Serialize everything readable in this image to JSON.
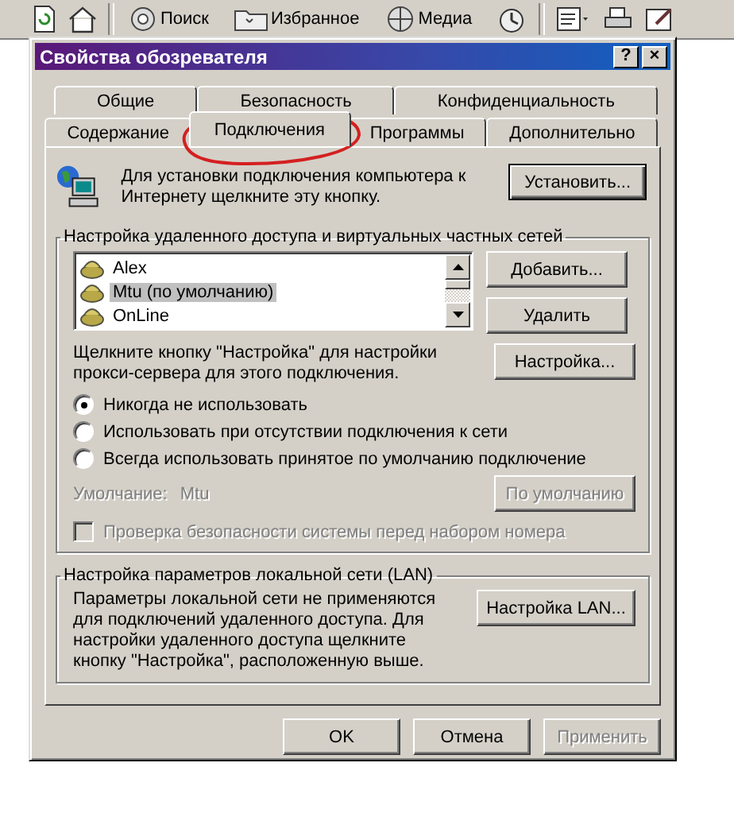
{
  "browser_toolbar": {
    "buttons": [
      {
        "label": "Поиск",
        "kind": "search"
      },
      {
        "label": "Избранное",
        "kind": "favorites"
      },
      {
        "label": "Медиа",
        "kind": "media"
      }
    ]
  },
  "window": {
    "title": "Свойства обозревателя",
    "title_buttons": [
      "?",
      "×"
    ]
  },
  "tab_rows": [
    [
      {
        "label": "Общие",
        "selected": false
      },
      {
        "label": "Безопасность",
        "selected": false
      },
      {
        "label": "Конфиденциальность",
        "selected": false
      }
    ],
    [
      {
        "label": "Содержание",
        "selected": false
      },
      {
        "label": "Подключения",
        "selected": true
      },
      {
        "label": "Программы",
        "selected": false
      },
      {
        "label": "Дополнительно",
        "selected": false
      }
    ]
  ],
  "setup": {
    "text": "Для установки подключения компьютера к Интернету щелкните эту кнопку.",
    "button": "Установить..."
  },
  "dialup": {
    "title": "Настройка удаленного доступа и виртуальных частных сетей",
    "connections": [
      {
        "name": "Alex",
        "selected": false
      },
      {
        "name": "Mtu (по умолчанию)",
        "selected": true
      },
      {
        "name": "OnLine",
        "selected": false
      }
    ],
    "buttons": [
      "Добавить...",
      "Удалить",
      "Настройка..."
    ],
    "hint": "Щелкните кнопку \"Настройка\" для настройки прокси-сервера для этого подключения.",
    "options": [
      {
        "label": "Никогда не использовать",
        "selected": true
      },
      {
        "label": "Использовать при отсутствии подключения к сети",
        "selected": false
      },
      {
        "label": "Всегда использовать принятое по умолчанию подключение",
        "selected": false
      }
    ],
    "default_label": "Умолчание:",
    "default_value": "Mtu",
    "default_disabled": true,
    "default_button": {
      "label": "По умолчанию",
      "disabled": true
    },
    "security_check": {
      "label": "Проверка безопасности системы перед набором номера",
      "checked": false,
      "disabled": true
    }
  },
  "lan": {
    "title": "Настройка параметров локальной сети (LAN)",
    "text": "Параметры локальной сети не применяются для подключений удаленного доступа. Для настройки удаленного доступа щелкните кнопку \"Настройка\", расположенную выше.",
    "button": "Настройка LAN..."
  },
  "footer_buttons": [
    {
      "label": "OK",
      "disabled": false
    },
    {
      "label": "Отмена",
      "disabled": false
    },
    {
      "label": "Применить",
      "disabled": true
    }
  ]
}
